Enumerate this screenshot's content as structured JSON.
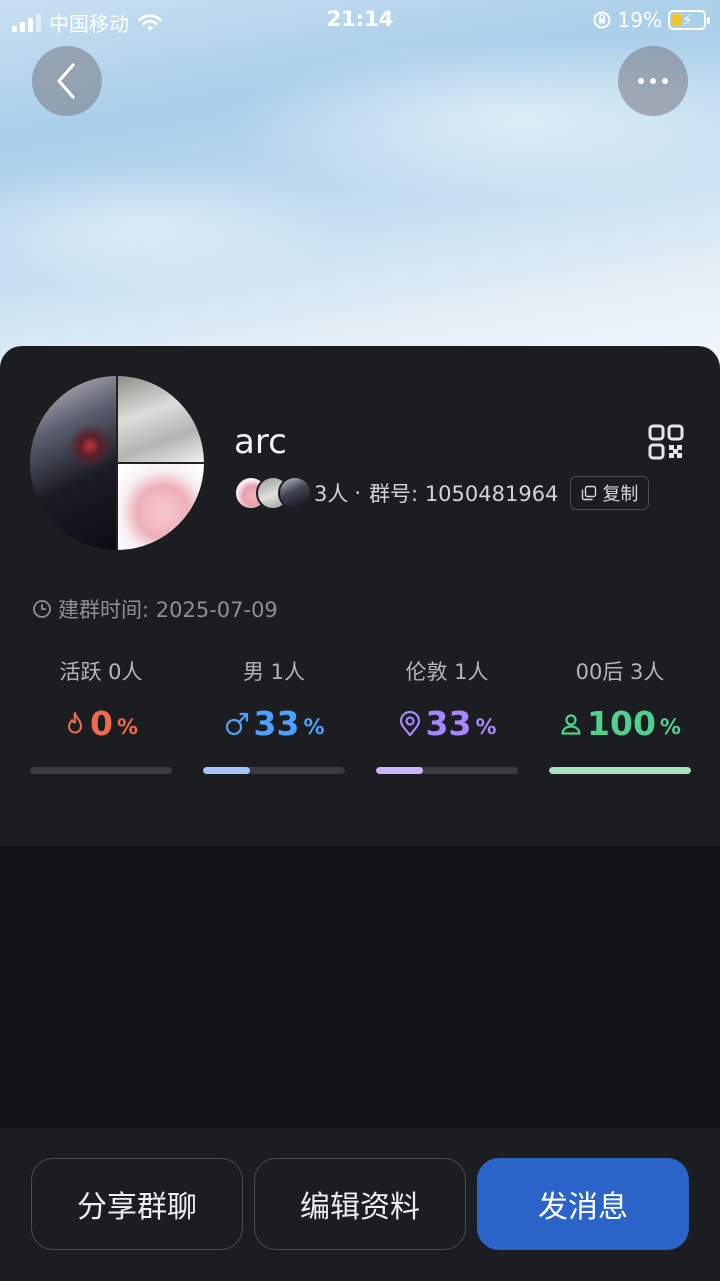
{
  "status_bar": {
    "carrier": "中国移动",
    "time": "21:14",
    "battery": "19%"
  },
  "header": {
    "back_icon": "chevron-left-icon",
    "more_icon": "more-horizontal-icon"
  },
  "group": {
    "name": "arc",
    "member_count": "3人",
    "separator": "·",
    "group_number_label": "群号: 1050481964",
    "copy_label": "复制",
    "created_label": "建群时间: 2025-07-09"
  },
  "stats": [
    {
      "label": "活跃 0人",
      "value": "0",
      "unit": "%",
      "icon": "flame-icon",
      "color": "#ef6a4f",
      "fill": 0,
      "bar_color": "#ef6a4f"
    },
    {
      "label": "男 1人",
      "value": "33",
      "unit": "%",
      "icon": "male-icon",
      "color": "#4ea1ff",
      "fill": 0.33,
      "bar_color": "#a8c4ff"
    },
    {
      "label": "伦敦 1人",
      "value": "33",
      "unit": "%",
      "icon": "location-pin-icon",
      "color": "#a587ff",
      "fill": 0.33,
      "bar_color": "#c9b6ff"
    },
    {
      "label": "00后 3人",
      "value": "100",
      "unit": "%",
      "icon": "person-icon",
      "color": "#4fd18b",
      "fill": 1.0,
      "bar_color": "#a6e3bf"
    }
  ],
  "actions": {
    "share": "分享群聊",
    "edit": "编辑资料",
    "send": "发消息"
  }
}
